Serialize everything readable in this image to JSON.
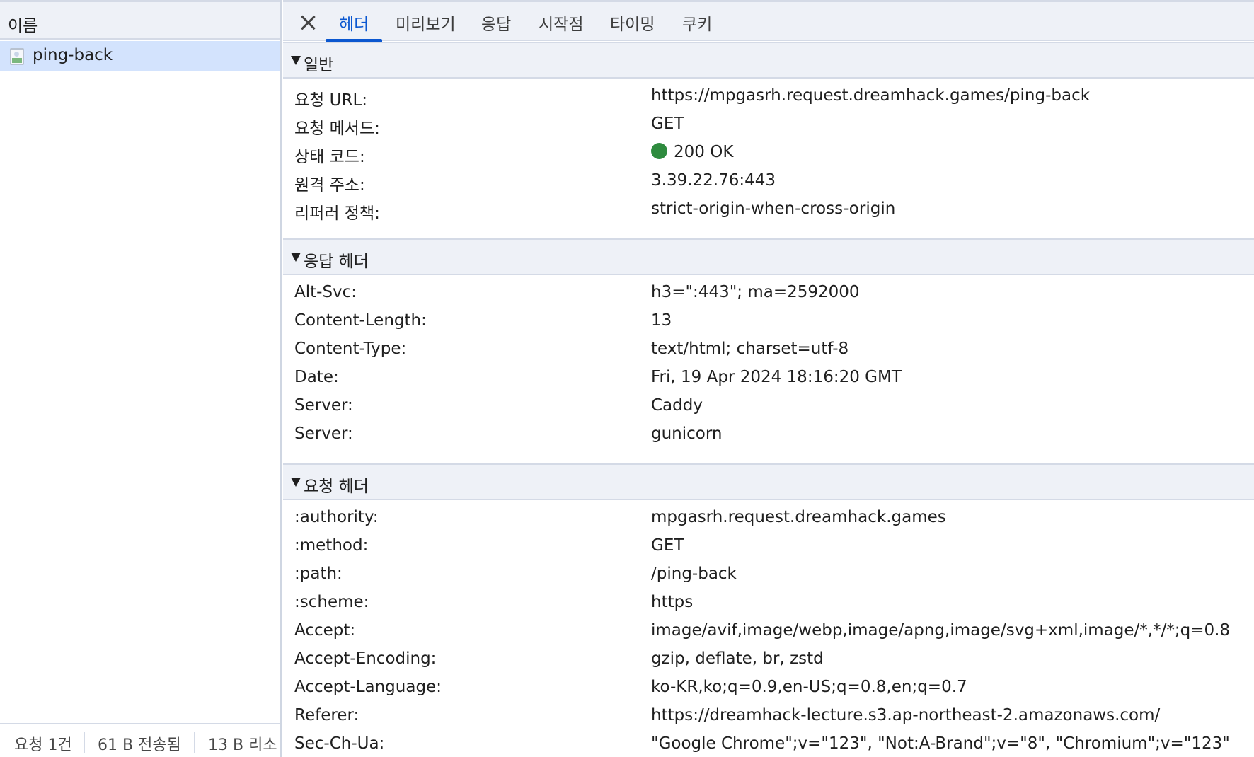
{
  "left": {
    "header": "이름",
    "request_name": "ping-back",
    "status": {
      "requests": "요청 1건",
      "transferred": "61 B 전송됨",
      "resources": "13 B 리소"
    }
  },
  "tabs": [
    "헤더",
    "미리보기",
    "응답",
    "시작점",
    "타이밍",
    "쿠키"
  ],
  "active_tab": "헤더",
  "sections": {
    "general": {
      "title": "일반",
      "rows": [
        {
          "key": "요청 URL:",
          "value": "https://mpgasrh.request.dreamhack.games/ping-back"
        },
        {
          "key": "요청 메서드:",
          "value": "GET"
        },
        {
          "key": "상태 코드:",
          "value": "200 OK"
        },
        {
          "key": "원격 주소:",
          "value": "3.39.22.76:443"
        },
        {
          "key": "리퍼러 정책:",
          "value": "strict-origin-when-cross-origin"
        }
      ]
    },
    "response_headers": {
      "title": "응답 헤더",
      "rows": [
        {
          "key": "Alt-Svc:",
          "value": "h3=\":443\"; ma=2592000"
        },
        {
          "key": "Content-Length:",
          "value": "13"
        },
        {
          "key": "Content-Type:",
          "value": "text/html; charset=utf-8"
        },
        {
          "key": "Date:",
          "value": "Fri, 19 Apr 2024 18:16:20 GMT"
        },
        {
          "key": "Server:",
          "value": "Caddy"
        },
        {
          "key": "Server:",
          "value": "gunicorn"
        }
      ]
    },
    "request_headers": {
      "title": "요청 헤더",
      "rows": [
        {
          "key": ":authority:",
          "value": "mpgasrh.request.dreamhack.games"
        },
        {
          "key": ":method:",
          "value": "GET"
        },
        {
          "key": ":path:",
          "value": "/ping-back"
        },
        {
          "key": ":scheme:",
          "value": "https"
        },
        {
          "key": "Accept:",
          "value": "image/avif,image/webp,image/apng,image/svg+xml,image/*,*/*;q=0.8"
        },
        {
          "key": "Accept-Encoding:",
          "value": "gzip, deflate, br, zstd"
        },
        {
          "key": "Accept-Language:",
          "value": "ko-KR,ko;q=0.9,en-US;q=0.8,en;q=0.7"
        },
        {
          "key": "Referer:",
          "value": "https://dreamhack-lecture.s3.ap-northeast-2.amazonaws.com/"
        },
        {
          "key": "Sec-Ch-Ua:",
          "value": "\"Google Chrome\";v=\"123\", \"Not:A-Brand\";v=\"8\", \"Chromium\";v=\"123\""
        }
      ]
    }
  },
  "colors": {
    "status_ok": "#2e8b3e",
    "accent": "#0b57d0",
    "selected_row": "#d3e3fd"
  }
}
